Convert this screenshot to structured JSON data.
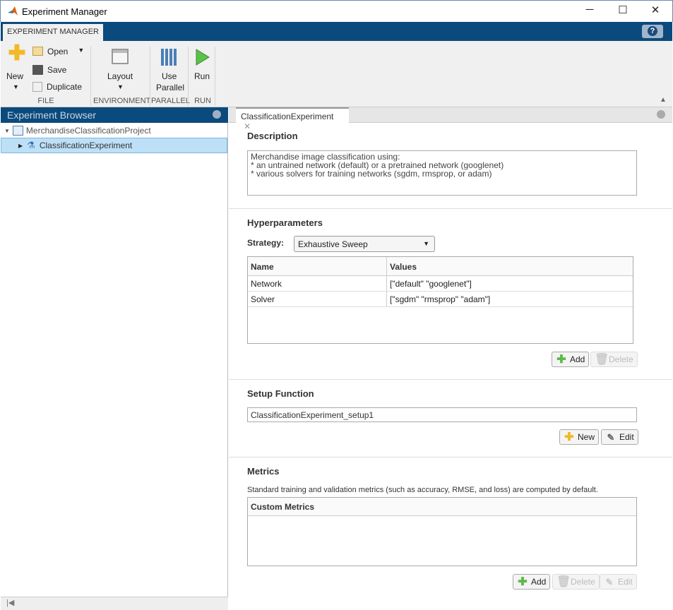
{
  "window": {
    "title": "Experiment Manager",
    "minimize": "─",
    "maximize": "☐",
    "close": "✕"
  },
  "ribbon": {
    "tab": "EXPERIMENT MANAGER",
    "help": "?",
    "new": "New",
    "open": "Open",
    "save": "Save",
    "duplicate": "Duplicate",
    "file_group": "FILE",
    "layout": "Layout",
    "environment_group": "ENVIRONMENT",
    "use_parallel_1": "Use",
    "use_parallel_2": "Parallel",
    "parallel_group": "PARALLEL",
    "run": "Run",
    "run_group": "RUN"
  },
  "browser": {
    "title": "Experiment Browser",
    "project": "MerchandiseClassificationProject",
    "experiment": "ClassificationExperiment"
  },
  "editor": {
    "tab": "ClassificationExperiment",
    "description": {
      "heading": "Description",
      "lines": [
        "Merchandise image classification using:",
        "* an untrained network (default) or a pretrained network (googlenet)",
        "* various solvers for training networks (sgdm, rmsprop, or adam)"
      ]
    },
    "hyperparameters": {
      "heading": "Hyperparameters",
      "strategy_label": "Strategy:",
      "strategy": "Exhaustive Sweep",
      "columns": [
        "Name",
        "Values"
      ],
      "rows": [
        [
          "Network",
          "[\"default\" \"googlenet\"]"
        ],
        [
          "Solver",
          "[\"sgdm\" \"rmsprop\" \"adam\"]"
        ]
      ],
      "add": "Add",
      "delete": "Delete"
    },
    "setup": {
      "heading": "Setup Function",
      "value": "ClassificationExperiment_setup1",
      "new": "New",
      "edit": "Edit"
    },
    "metrics": {
      "heading": "Metrics",
      "note": "Standard training and validation metrics (such as accuracy, RMSE, and loss) are computed by default.",
      "column": "Custom Metrics",
      "add": "Add",
      "delete": "Delete",
      "edit": "Edit"
    }
  }
}
